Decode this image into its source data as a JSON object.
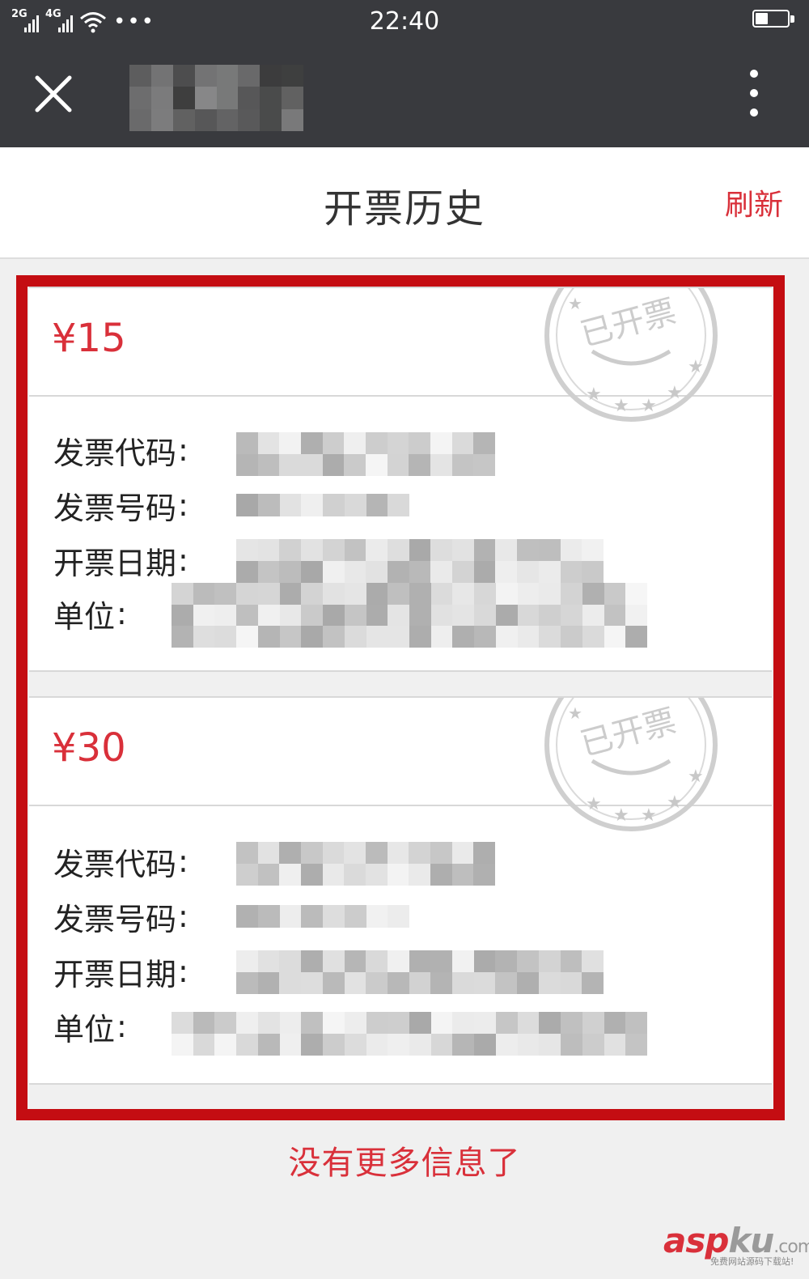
{
  "status_bar": {
    "network_1": "2G",
    "network_2": "4G",
    "more_indicator": "•••",
    "time": "22:40",
    "battery_level_percent": 40
  },
  "nav": {
    "close_icon": "close-icon",
    "more_icon": "more-vertical-icon"
  },
  "header": {
    "title": "开票历史",
    "refresh_label": "刷新"
  },
  "labels": {
    "invoice_code": "发票代码",
    "invoice_number": "发票号码",
    "invoice_date": "开票日期",
    "unit": "单位",
    "colon": ":"
  },
  "stamp": {
    "text": "已开票",
    "icon": "issued-stamp-icon"
  },
  "invoices": [
    {
      "amount": "¥15"
    },
    {
      "amount": "¥30"
    }
  ],
  "footer": {
    "no_more": "没有更多信息了"
  },
  "watermark": {
    "main_a": "asp",
    "main_b": "ku",
    "main_c": ".com",
    "sub": "免费网站源码下载站!"
  },
  "colors": {
    "accent_red": "#d9303a",
    "highlight_red": "#c40d12",
    "bar_dark": "#393a3e",
    "page_bg": "#f0f0f0"
  }
}
